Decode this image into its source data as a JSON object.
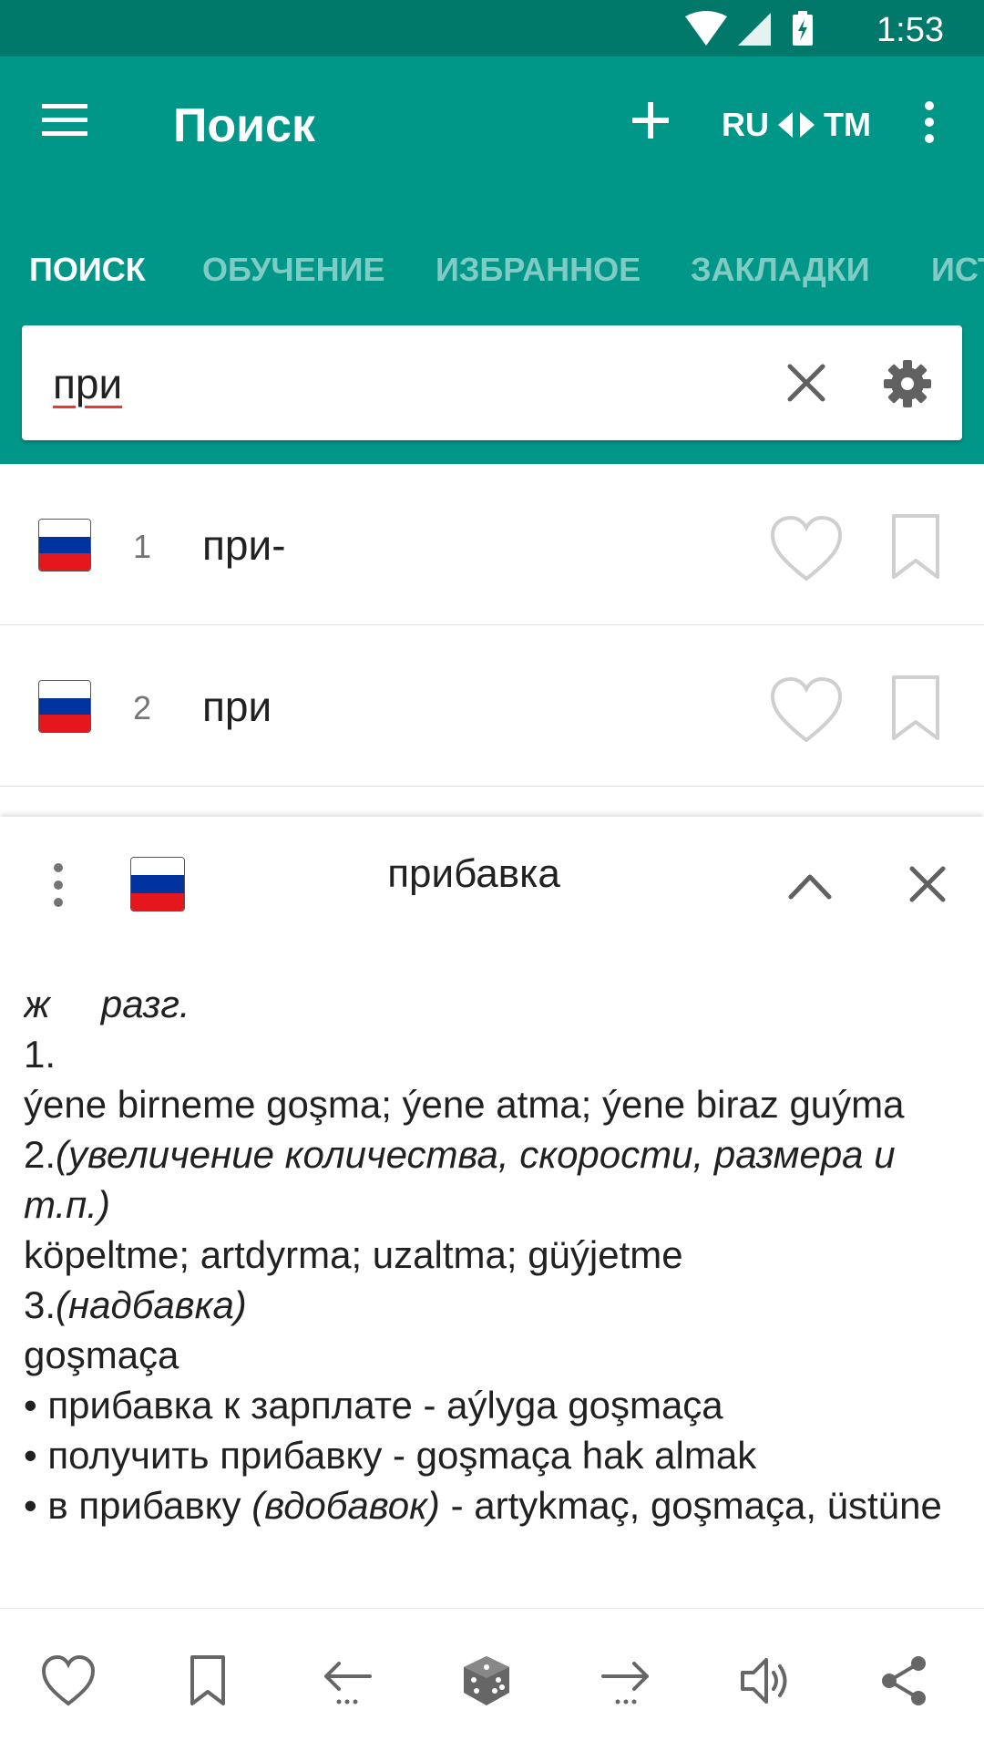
{
  "status_bar": {
    "time": "1:53",
    "icons": [
      "wifi-icon",
      "signal-icon",
      "battery-charging-icon"
    ]
  },
  "app_bar": {
    "title": "Поиск",
    "lang_from": "RU",
    "lang_to": "TM",
    "icons": [
      "menu-icon",
      "plus-icon",
      "swap-arrows-icon",
      "more-vertical-icon"
    ]
  },
  "tabs": [
    {
      "label": "ПОИСК",
      "active": true
    },
    {
      "label": "ОБУЧЕНИЕ",
      "active": false
    },
    {
      "label": "ИЗБРАННОЕ",
      "active": false
    },
    {
      "label": "ЗАКЛАДКИ",
      "active": false
    },
    {
      "label": "ИСТ",
      "active": false
    }
  ],
  "search": {
    "value": "при",
    "icons": [
      "close-icon",
      "gear-icon"
    ]
  },
  "results": [
    {
      "num": "1",
      "word": "при-",
      "flag": "russia-flag-icon"
    },
    {
      "num": "2",
      "word": "при",
      "flag": "russia-flag-icon"
    }
  ],
  "entry_panel": {
    "word": "прибавка",
    "icons": [
      "more-vertical-icon",
      "russia-flag-icon",
      "chevron-up-icon",
      "close-icon"
    ],
    "lines": {
      "gram_1": "ж",
      "gram_2": "разг.",
      "n1": "1.",
      "t1": "ýene birneme goşma; ýene atma; ýene biraz guýma",
      "n2": "2.",
      "c2": "(увеличение количества, скорости, размера и т.п.)",
      "t2": "köpeltme; artdyrma; uzaltma; güýjetme",
      "n3": "3.",
      "c3": "(надбавка)",
      "t3": "goşmaça",
      "ex1": "• прибавка к зарплате - aýlyga goşmaça",
      "ex2": "• получить прибавку - goşmaça hak almak",
      "ex3_a": "• в прибавку ",
      "ex3_b": "(вдобавок)",
      "ex3_c": " - artykmaç, goşmaça, üstüne"
    }
  },
  "bottom_bar": {
    "icons": [
      "heart-icon",
      "bookmark-icon",
      "back-arrow-icon",
      "dice-icon",
      "forward-arrow-icon",
      "speaker-icon",
      "share-icon"
    ]
  },
  "colors": {
    "primary": "#009688",
    "primary_dark": "#00796b",
    "flag_white": "#ffffff",
    "flag_blue": "#0033a0",
    "flag_red": "#e4181c"
  }
}
